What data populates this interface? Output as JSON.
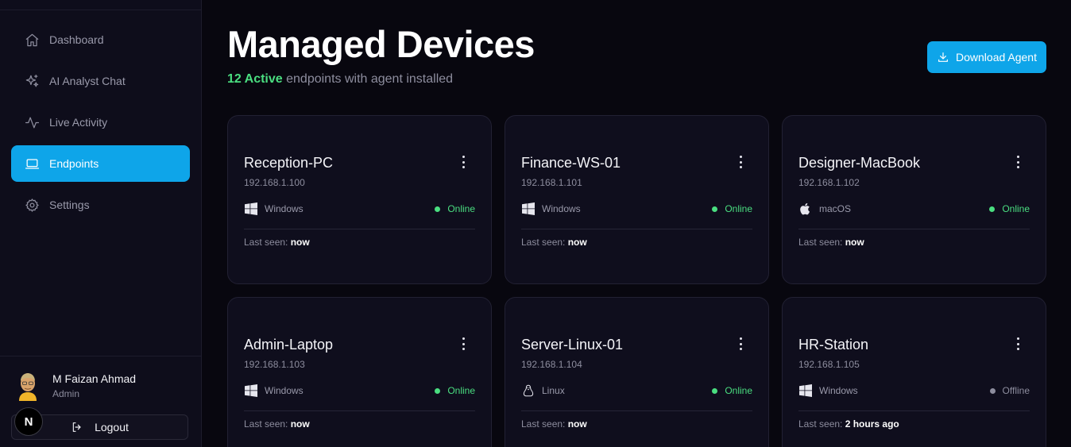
{
  "sidebar": {
    "items": [
      {
        "label": "Dashboard",
        "icon": "home-icon",
        "active": false
      },
      {
        "label": "AI Analyst Chat",
        "icon": "sparkles-icon",
        "active": false
      },
      {
        "label": "Live Activity",
        "icon": "activity-icon",
        "active": false
      },
      {
        "label": "Endpoints",
        "icon": "laptop-icon",
        "active": true
      },
      {
        "label": "Settings",
        "icon": "gear-icon",
        "active": false
      }
    ],
    "user": {
      "name": "M Faizan Ahmad",
      "role": "Admin"
    },
    "logout_label": "Logout",
    "badge": "N"
  },
  "header": {
    "title": "Managed Devices",
    "active_count": "12 Active",
    "subtitle_rest": " endpoints with agent installed",
    "download_label": "Download Agent"
  },
  "devices": [
    {
      "name": "Reception-PC",
      "ip": "192.168.1.100",
      "os": "Windows",
      "os_icon": "windows-icon",
      "status": "Online",
      "last_seen_label": "Last seen:",
      "last_seen": "now"
    },
    {
      "name": "Finance-WS-01",
      "ip": "192.168.1.101",
      "os": "Windows",
      "os_icon": "windows-icon",
      "status": "Online",
      "last_seen_label": "Last seen:",
      "last_seen": "now"
    },
    {
      "name": "Designer-MacBook",
      "ip": "192.168.1.102",
      "os": "macOS",
      "os_icon": "apple-icon",
      "status": "Online",
      "last_seen_label": "Last seen:",
      "last_seen": "now"
    },
    {
      "name": "Admin-Laptop",
      "ip": "192.168.1.103",
      "os": "Windows",
      "os_icon": "windows-icon",
      "status": "Online",
      "last_seen_label": "Last seen:",
      "last_seen": "now"
    },
    {
      "name": "Server-Linux-01",
      "ip": "192.168.1.104",
      "os": "Linux",
      "os_icon": "linux-icon",
      "status": "Online",
      "last_seen_label": "Last seen:",
      "last_seen": "now"
    },
    {
      "name": "HR-Station",
      "ip": "192.168.1.105",
      "os": "Windows",
      "os_icon": "windows-icon",
      "status": "Offline",
      "last_seen_label": "Last seen:",
      "last_seen": "2 hours ago"
    }
  ],
  "colors": {
    "accent": "#0ea5e9",
    "online": "#4ade80",
    "offline": "#8d8d9e",
    "background": "#08070f",
    "card": "#0f0e1d"
  }
}
